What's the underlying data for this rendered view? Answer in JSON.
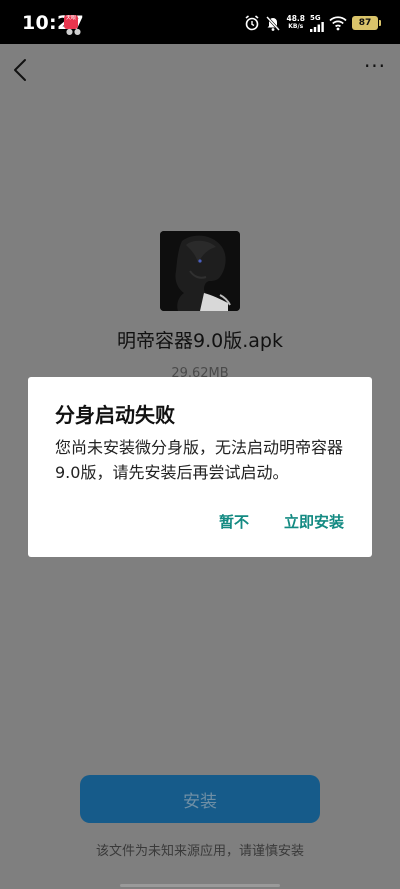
{
  "status_bar": {
    "time": "10:27",
    "notification_badge": "天眼",
    "notification_dots": "●●",
    "net_speed_value": "48.8",
    "net_speed_unit": "KB/s",
    "network_type": "5G",
    "battery_level": "87",
    "icons": [
      "alarm-icon",
      "mute-icon",
      "signal-icon",
      "wifi-icon",
      "battery-icon"
    ]
  },
  "nav": {
    "back_icon": "chevron-left-icon",
    "more_label": "···"
  },
  "app": {
    "name": "明帝容器9.0版.apk",
    "size": "29.62MB"
  },
  "dialog": {
    "title": "分身启动失败",
    "message": "您尚未安装微分身版，无法启动明帝容器9.0版，请先安装后再尝试启动。",
    "cancel_label": "暂不",
    "confirm_label": "立即安装"
  },
  "bottom": {
    "install_label": "安装",
    "warning": "该文件为未知来源应用，请谨慎安装"
  },
  "colors": {
    "accent": "#138a82",
    "install_button": "#165b8a",
    "overlay": "#7f7f7f",
    "battery": "#d9c36a"
  }
}
